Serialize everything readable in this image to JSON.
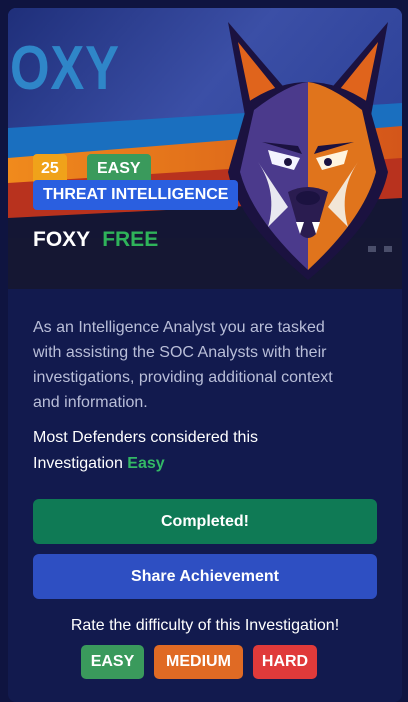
{
  "hero": {
    "brand_text": "OXY",
    "points": "25",
    "difficulty": "EASY",
    "category": "THREAT INTELLIGENCE",
    "name": "FOXY",
    "price": "FREE"
  },
  "description": "As an Intelligence Analyst you are tasked with assisting the SOC Analysts with their investigations, providing additional context and information.",
  "consensus": {
    "prefix": "Most Defenders considered this Investigation",
    "level": "Easy"
  },
  "buttons": {
    "completed": "Completed!",
    "share": "Share Achievement"
  },
  "rating": {
    "prompt": "Rate the difficulty of this Investigation!",
    "options": [
      "EASY",
      "MEDIUM",
      "HARD"
    ]
  },
  "colors": {
    "card_bg": "#121a4e",
    "points_badge": "#f0a21a",
    "easy_green": "#3a9a5c",
    "category_blue": "#2a5fe0",
    "free_green": "#2fb35a",
    "completed_btn": "#0f7a55",
    "share_btn": "#2e4fc2",
    "medium_orange": "#e06a24",
    "hard_red": "#e03a3a"
  },
  "icons": {
    "mascot": "fox-mascot-icon"
  }
}
